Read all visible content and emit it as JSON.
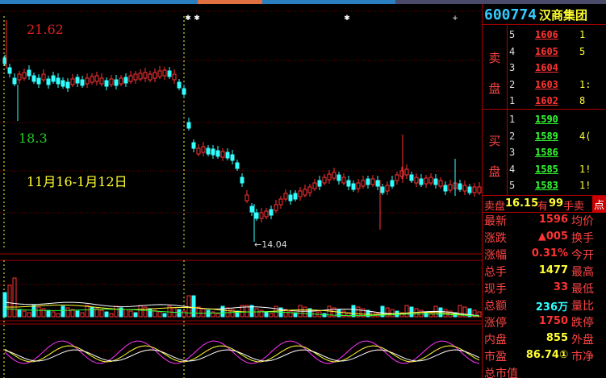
{
  "colors": {
    "up": "#ff3333",
    "down": "#33ffff",
    "accent": "#ffff33",
    "grid": "#a00000"
  },
  "chart": {
    "high_label": "21.62",
    "low_label": "18.3",
    "date_range_label": "11月16-1月12日",
    "marker_label": "←14.04"
  },
  "stock": {
    "code": "600774",
    "name": "汉商集团"
  },
  "orderbook": {
    "sell_label": "卖盘",
    "buy_label": "买盘",
    "sell": [
      {
        "level": "5",
        "price": "1606",
        "vol": "1"
      },
      {
        "level": "4",
        "price": "1605",
        "vol": "5"
      },
      {
        "level": "3",
        "price": "1604",
        "vol": ""
      },
      {
        "level": "2",
        "price": "1603",
        "vol": "1:"
      },
      {
        "level": "1",
        "price": "1602",
        "vol": "8"
      }
    ],
    "buy": [
      {
        "level": "1",
        "price": "1590",
        "vol": ""
      },
      {
        "level": "2",
        "price": "1589",
        "vol": "4("
      },
      {
        "level": "3",
        "price": "1586",
        "vol": ""
      },
      {
        "level": "4",
        "price": "1585",
        "vol": "1!"
      },
      {
        "level": "5",
        "price": "1583",
        "vol": "1!"
      }
    ]
  },
  "sellbar": {
    "prefix": "卖盘",
    "price": "16.15",
    "mid": "有",
    "qty": "99",
    "suffix": "手卖",
    "tail": "点"
  },
  "quote": [
    {
      "k": "最新",
      "v": "1596",
      "k2": "均价",
      "c": "#ff3333"
    },
    {
      "k": "涨跌",
      "v": "▲005",
      "k2": "换手",
      "c": "#ff3333"
    },
    {
      "k": "涨幅",
      "v": "0.31%",
      "k2": "今开",
      "c": "#ff3333"
    },
    {
      "k": "总手",
      "v": "1477",
      "k2": "最高",
      "c": "#ffff33"
    },
    {
      "k": "现手",
      "v": "33",
      "k2": "最低",
      "c": "#ff3333"
    },
    {
      "k": "总额",
      "v": "236万",
      "k2": "量比",
      "c": "#33ffff"
    },
    {
      "k": "涨停",
      "v": "1750",
      "k2": "跌停",
      "c": "#ff3333"
    },
    {
      "k": "内盘",
      "v": "855",
      "k2": "外盘",
      "c": "#ffff33"
    },
    {
      "k": "市盈",
      "v": "86.74①",
      "k2": "市净",
      "c": "#ffff33"
    },
    {
      "k": "总市值",
      "v": "",
      "k2": "",
      "c": "#ffff33"
    }
  ]
}
